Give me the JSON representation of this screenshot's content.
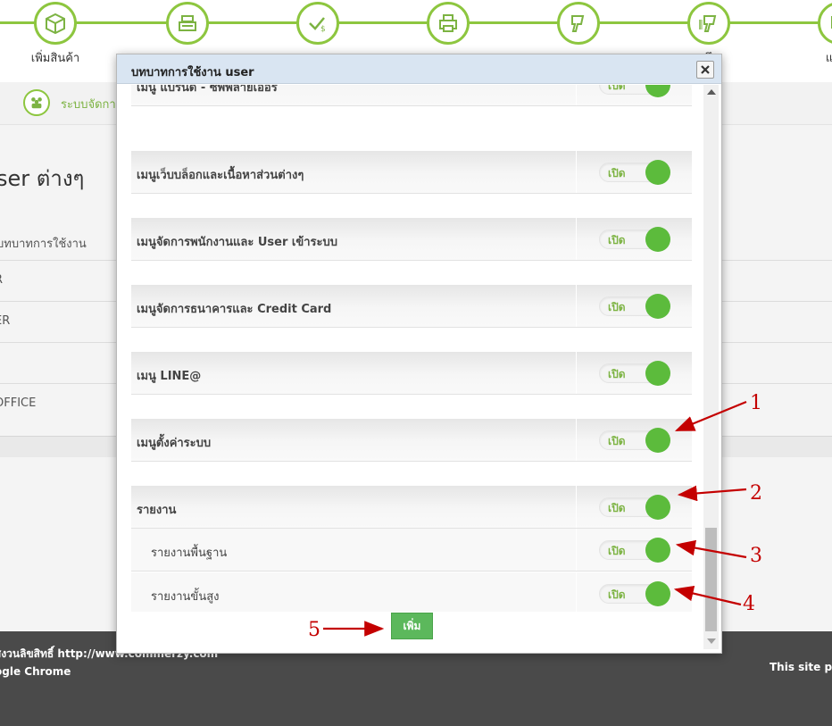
{
  "topnav": {
    "items": [
      {
        "label": "เพิ่มสินค้า",
        "icon": "box-icon"
      },
      {
        "label": "",
        "icon": "cash-register-icon"
      },
      {
        "label": "",
        "icon": "payment-check-icon"
      },
      {
        "label": "",
        "icon": "printer-icon"
      },
      {
        "label": "",
        "icon": "barcode-scanner-icon"
      },
      {
        "label": "ารึก",
        "icon": "barcode-scan-icon"
      },
      {
        "label": "แจ้งส",
        "icon": "notify-icon"
      }
    ]
  },
  "subbar": {
    "text": "ระบบจัดกา"
  },
  "background": {
    "page_title": "ser ต่างๆ",
    "table_header": "บทบาทการใช้งาน",
    "rows": [
      "R",
      "ER",
      "",
      "OFFICE"
    ]
  },
  "footer": {
    "line1": "สงวนลิขสิทธิ์ http://www.commerzy.com",
    "line2": "ogle Chrome",
    "line3": "This site po"
  },
  "modal": {
    "title": "บทบาทการใช้งาน user",
    "toggle_label": "เปิด",
    "add_button": "เพิ่ม",
    "rows": [
      {
        "label": "เมนู แบรนด์ - ซัพพลายเออร์",
        "type": "main",
        "state": "on"
      },
      {
        "label": "เมนูเว็บบล็อกและเนื้อหาส่วนต่างๆ",
        "type": "main",
        "state": "on"
      },
      {
        "label": "เมนูจัดการพนักงานและ User เข้าระบบ",
        "type": "main",
        "state": "on"
      },
      {
        "label": "เมนูจัดการธนาคารและ Credit Card",
        "type": "main",
        "state": "on"
      },
      {
        "label": "เมนู LINE@",
        "type": "main",
        "state": "on"
      },
      {
        "label": "เมนูตั้งค่าระบบ",
        "type": "main",
        "state": "on"
      },
      {
        "label": "รายงาน",
        "type": "main",
        "state": "on"
      },
      {
        "label": "รายงานพื้นฐาน",
        "type": "sub",
        "state": "on"
      },
      {
        "label": "รายงานขั้นสูง",
        "type": "sub",
        "state": "on"
      }
    ]
  },
  "annotations": [
    "1",
    "2",
    "3",
    "4",
    "5"
  ],
  "colors": {
    "accent_green": "#8dc63f",
    "toggle_knob": "#5cbb3c",
    "button_green": "#5cb85c",
    "arrow_red": "#c40000",
    "modal_header": "#d9e5f2",
    "footer_bg": "#4a4a4a"
  }
}
